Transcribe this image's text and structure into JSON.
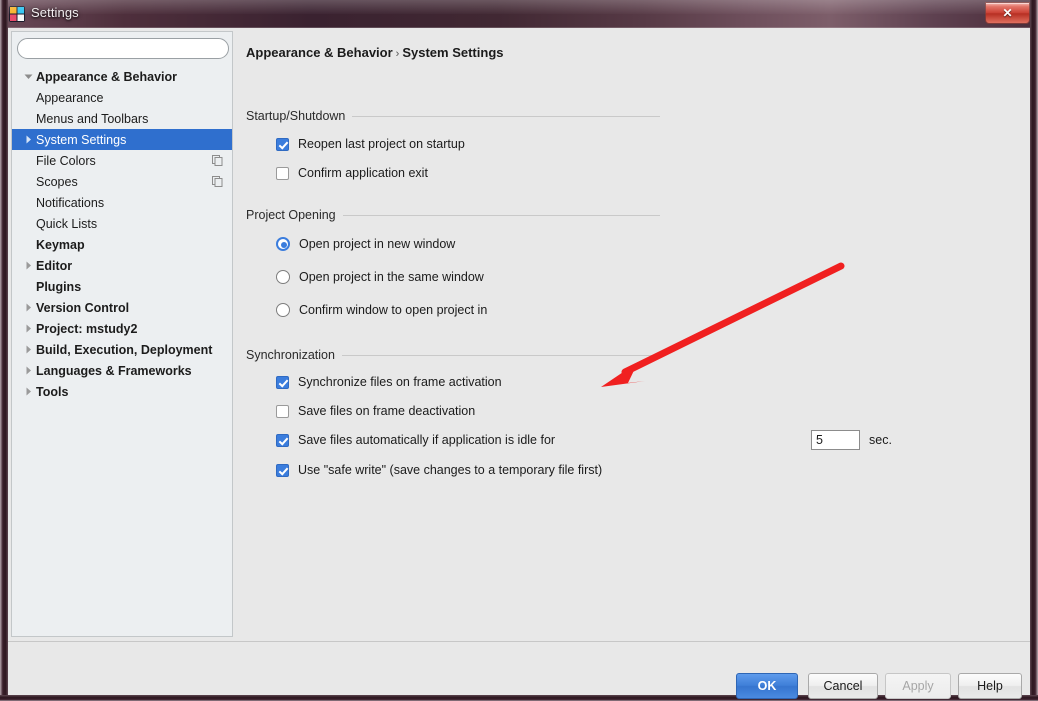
{
  "window": {
    "title": "Settings",
    "app_icon": "intellij-logo-icon",
    "close_label": "✕"
  },
  "sidebar": {
    "search": {
      "value": "",
      "placeholder": "",
      "icon": "search-icon"
    },
    "items": [
      {
        "label": "Appearance & Behavior",
        "level": 0,
        "bold": true,
        "twisty": "expanded",
        "selected": false,
        "icon": null
      },
      {
        "label": "Appearance",
        "level": 1,
        "bold": false,
        "twisty": "none",
        "selected": false,
        "icon": null
      },
      {
        "label": "Menus and Toolbars",
        "level": 1,
        "bold": false,
        "twisty": "none",
        "selected": false,
        "icon": null
      },
      {
        "label": "System Settings",
        "level": 1,
        "bold": false,
        "twisty": "collapsed",
        "selected": true,
        "icon": null
      },
      {
        "label": "File Colors",
        "level": 1,
        "bold": false,
        "twisty": "none",
        "selected": false,
        "icon": "copy-icon"
      },
      {
        "label": "Scopes",
        "level": 1,
        "bold": false,
        "twisty": "none",
        "selected": false,
        "icon": "copy-icon"
      },
      {
        "label": "Notifications",
        "level": 1,
        "bold": false,
        "twisty": "none",
        "selected": false,
        "icon": null
      },
      {
        "label": "Quick Lists",
        "level": 1,
        "bold": false,
        "twisty": "none",
        "selected": false,
        "icon": null
      },
      {
        "label": "Keymap",
        "level": 0,
        "bold": true,
        "twisty": "none",
        "selected": false,
        "icon": null
      },
      {
        "label": "Editor",
        "level": 0,
        "bold": true,
        "twisty": "collapsed",
        "selected": false,
        "icon": null
      },
      {
        "label": "Plugins",
        "level": 0,
        "bold": true,
        "twisty": "none",
        "selected": false,
        "icon": null
      },
      {
        "label": "Version Control",
        "level": 0,
        "bold": true,
        "twisty": "collapsed",
        "selected": false,
        "icon": null
      },
      {
        "label": "Project: mstudy2",
        "level": 0,
        "bold": true,
        "twisty": "collapsed",
        "selected": false,
        "icon": null
      },
      {
        "label": "Build, Execution, Deployment",
        "level": 0,
        "bold": true,
        "twisty": "collapsed",
        "selected": false,
        "icon": null
      },
      {
        "label": "Languages & Frameworks",
        "level": 0,
        "bold": true,
        "twisty": "collapsed",
        "selected": false,
        "icon": null
      },
      {
        "label": "Tools",
        "level": 0,
        "bold": true,
        "twisty": "collapsed",
        "selected": false,
        "icon": null
      }
    ]
  },
  "content": {
    "breadcrumb": {
      "root": "Appearance & Behavior",
      "separator": "›",
      "current": "System Settings"
    },
    "groups": [
      {
        "title": "Startup/Shutdown"
      },
      {
        "title": "Project Opening"
      },
      {
        "title": "Synchronization"
      }
    ],
    "startup_shutdown": [
      {
        "label": "Reopen last project on startup",
        "checked": true
      },
      {
        "label": "Confirm application exit",
        "checked": false
      }
    ],
    "project_opening": [
      {
        "label": "Open project in new window",
        "selected": true
      },
      {
        "label": "Open project in the same window",
        "selected": false
      },
      {
        "label": "Confirm window to open project in",
        "selected": false
      }
    ],
    "synchronization": [
      {
        "label": "Synchronize files on frame activation",
        "checked": true
      },
      {
        "label": "Save files on frame deactivation",
        "checked": false
      },
      {
        "label": "Save files automatically if application is idle for",
        "checked": true
      },
      {
        "label": "Use \"safe write\" (save changes to a temporary file first)",
        "checked": true
      }
    ],
    "idle_timer": {
      "value": "5",
      "unit": "sec."
    }
  },
  "footer": {
    "ok": "OK",
    "cancel": "Cancel",
    "apply": "Apply",
    "help": "Help"
  },
  "annotation": {
    "type": "arrow",
    "color": "#f02020",
    "points_at": "idle-timer-input"
  },
  "colors": {
    "accent": "#3b7ddd",
    "selection": "#2f6fce",
    "annotation": "#f02020",
    "window_bg": "#e8e8e8",
    "panel_bg": "#eceff1"
  }
}
